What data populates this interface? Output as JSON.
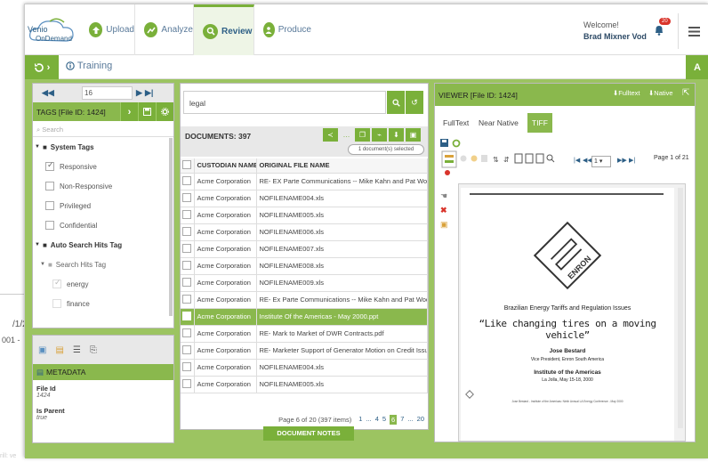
{
  "background": {
    "date_fragment": "/1/20",
    "num_fragment": "001 -",
    "footer_fragment": "rill: ve"
  },
  "logo": {
    "line1": "Venio",
    "line2": "OnDemand"
  },
  "nav": {
    "tabs": [
      {
        "label": "Upload",
        "icon": "upload-icon"
      },
      {
        "label": "Analyze",
        "icon": "analyze-icon"
      },
      {
        "label": "Review",
        "icon": "review-search-icon"
      },
      {
        "label": "Produce",
        "icon": "produce-icon"
      }
    ]
  },
  "user": {
    "welcome": "Welcome!",
    "name": "Brad Mixner Vod",
    "notifications": "20"
  },
  "subbar": {
    "project": "Training",
    "right_button": "A"
  },
  "tags": {
    "page_value": "16",
    "title": "TAGS [File ID: 1424]",
    "search_placeholder": "Search",
    "system_group": "System Tags",
    "system_items": [
      "Responsive",
      "Non-Responsive",
      "Privileged",
      "Confidential"
    ],
    "auto_group": "Auto Search Hits Tag",
    "auto_sub": "Search Hits Tag",
    "auto_items": [
      "energy",
      "finance"
    ]
  },
  "metadata": {
    "title": "METADATA",
    "fields": [
      {
        "label": "File Id",
        "value": "1424"
      },
      {
        "label": "Is Parent",
        "value": "true"
      }
    ]
  },
  "documents": {
    "search_value": "legal",
    "title": "DOCUMENTS: 397",
    "selected_text": "1 document(s) selected",
    "columns": [
      "CUSTODIAN NAME",
      "ORIGINAL FILE NAME"
    ],
    "rows": [
      {
        "custodian": "Acme Corporation",
        "file": "RE- EX Parte Communications -- Mike Kahn and Pat Wood or",
        "checked": false
      },
      {
        "custodian": "Acme Corporation",
        "file": "NOFILENAME004.xls",
        "checked": false
      },
      {
        "custodian": "Acme Corporation",
        "file": "NOFILENAME005.xls",
        "checked": false
      },
      {
        "custodian": "Acme Corporation",
        "file": "NOFILENAME006.xls",
        "checked": false
      },
      {
        "custodian": "Acme Corporation",
        "file": "NOFILENAME007.xls",
        "checked": false
      },
      {
        "custodian": "Acme Corporation",
        "file": "NOFILENAME008.xls",
        "checked": false
      },
      {
        "custodian": "Acme Corporation",
        "file": "NOFILENAME009.xls",
        "checked": false
      },
      {
        "custodian": "Acme Corporation",
        "file": "RE- Ex Parte Communications -- Mike Kahn and Pat Wood or",
        "checked": false
      },
      {
        "custodian": "Acme Corporation",
        "file": "Institute Of the Americas - May 2000.ppt",
        "checked": true
      },
      {
        "custodian": "Acme Corporation",
        "file": "RE- Mark to Market of DWR Contracts.pdf",
        "checked": false
      },
      {
        "custodian": "Acme Corporation",
        "file": "RE- Marketer Support of Generator Motion on Credit Issues.p",
        "checked": false
      },
      {
        "custodian": "Acme Corporation",
        "file": "NOFILENAME004.xls",
        "checked": false
      },
      {
        "custodian": "Acme Corporation",
        "file": "NOFILENAME005.xls",
        "checked": false
      }
    ],
    "page_info": "Page 6 of 20 (397 items)",
    "pages": [
      "1",
      "...",
      "4",
      "5",
      "6",
      "7",
      "...",
      "20"
    ],
    "current_page": "6",
    "notes_button": "DOCUMENT NOTES"
  },
  "viewer": {
    "title": "VIEWER [File ID: 1424]",
    "fulltext_btn": "Fulltext",
    "native_btn": "Native",
    "tabs": [
      "FullText",
      "Near Native",
      "TIFF"
    ],
    "active_tab": "TIFF",
    "page_select": "1",
    "page_info": "Page 1 of 21",
    "doc": {
      "brand": "ENRON",
      "heading": "Brazilian Energy Tariffs and Regulation Issues",
      "quote": "“Like changing tires on a moving vehicle”",
      "presenter": "Jose Bestard",
      "role": "Vice President, Enron South America",
      "venue": "Institute of the Americas",
      "place": "La Jolla, May 15-18, 2000",
      "footer": "Jose Bestard - Institute of the Americas: Ninth Annual LA Energy Conference - May 2000"
    }
  },
  "colors": {
    "accent": "#7ab03a",
    "accent_light": "#8ab84d",
    "workspace": "#9cc461",
    "link": "#2d5f86"
  }
}
